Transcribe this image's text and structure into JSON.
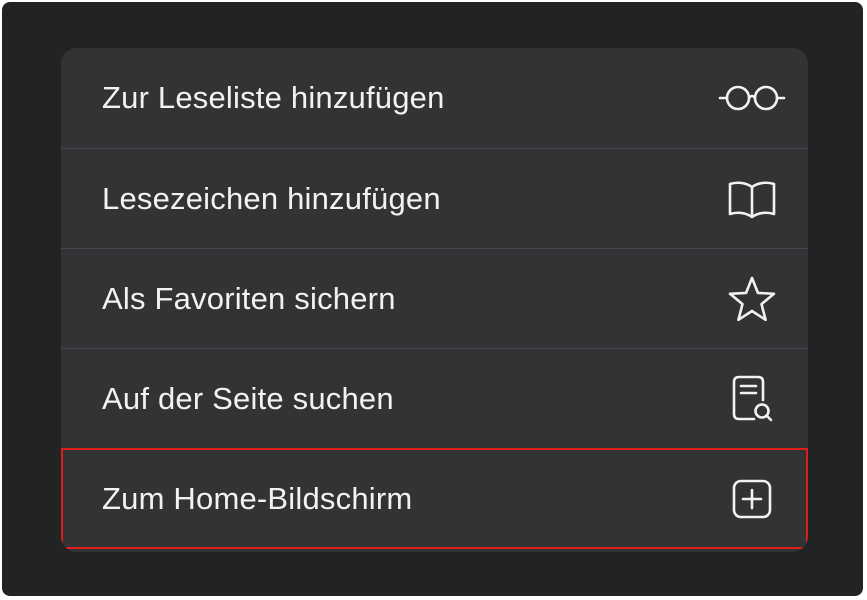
{
  "menu": {
    "items": [
      {
        "label": "Zur Leseliste hinzufügen",
        "icon": "glasses-icon"
      },
      {
        "label": "Lesezeichen hinzufügen",
        "icon": "book-icon"
      },
      {
        "label": "Als Favoriten sichern",
        "icon": "star-icon"
      },
      {
        "label": "Auf der Seite suchen",
        "icon": "document-search-icon"
      },
      {
        "label": "Zum Home-Bildschirm",
        "icon": "plus-square-icon",
        "highlighted": true
      }
    ]
  },
  "colors": {
    "background": "#222325",
    "menu_background": "#333335",
    "separator": "#46464a",
    "text": "#f2f2f2",
    "highlight": "#e01d1d"
  }
}
